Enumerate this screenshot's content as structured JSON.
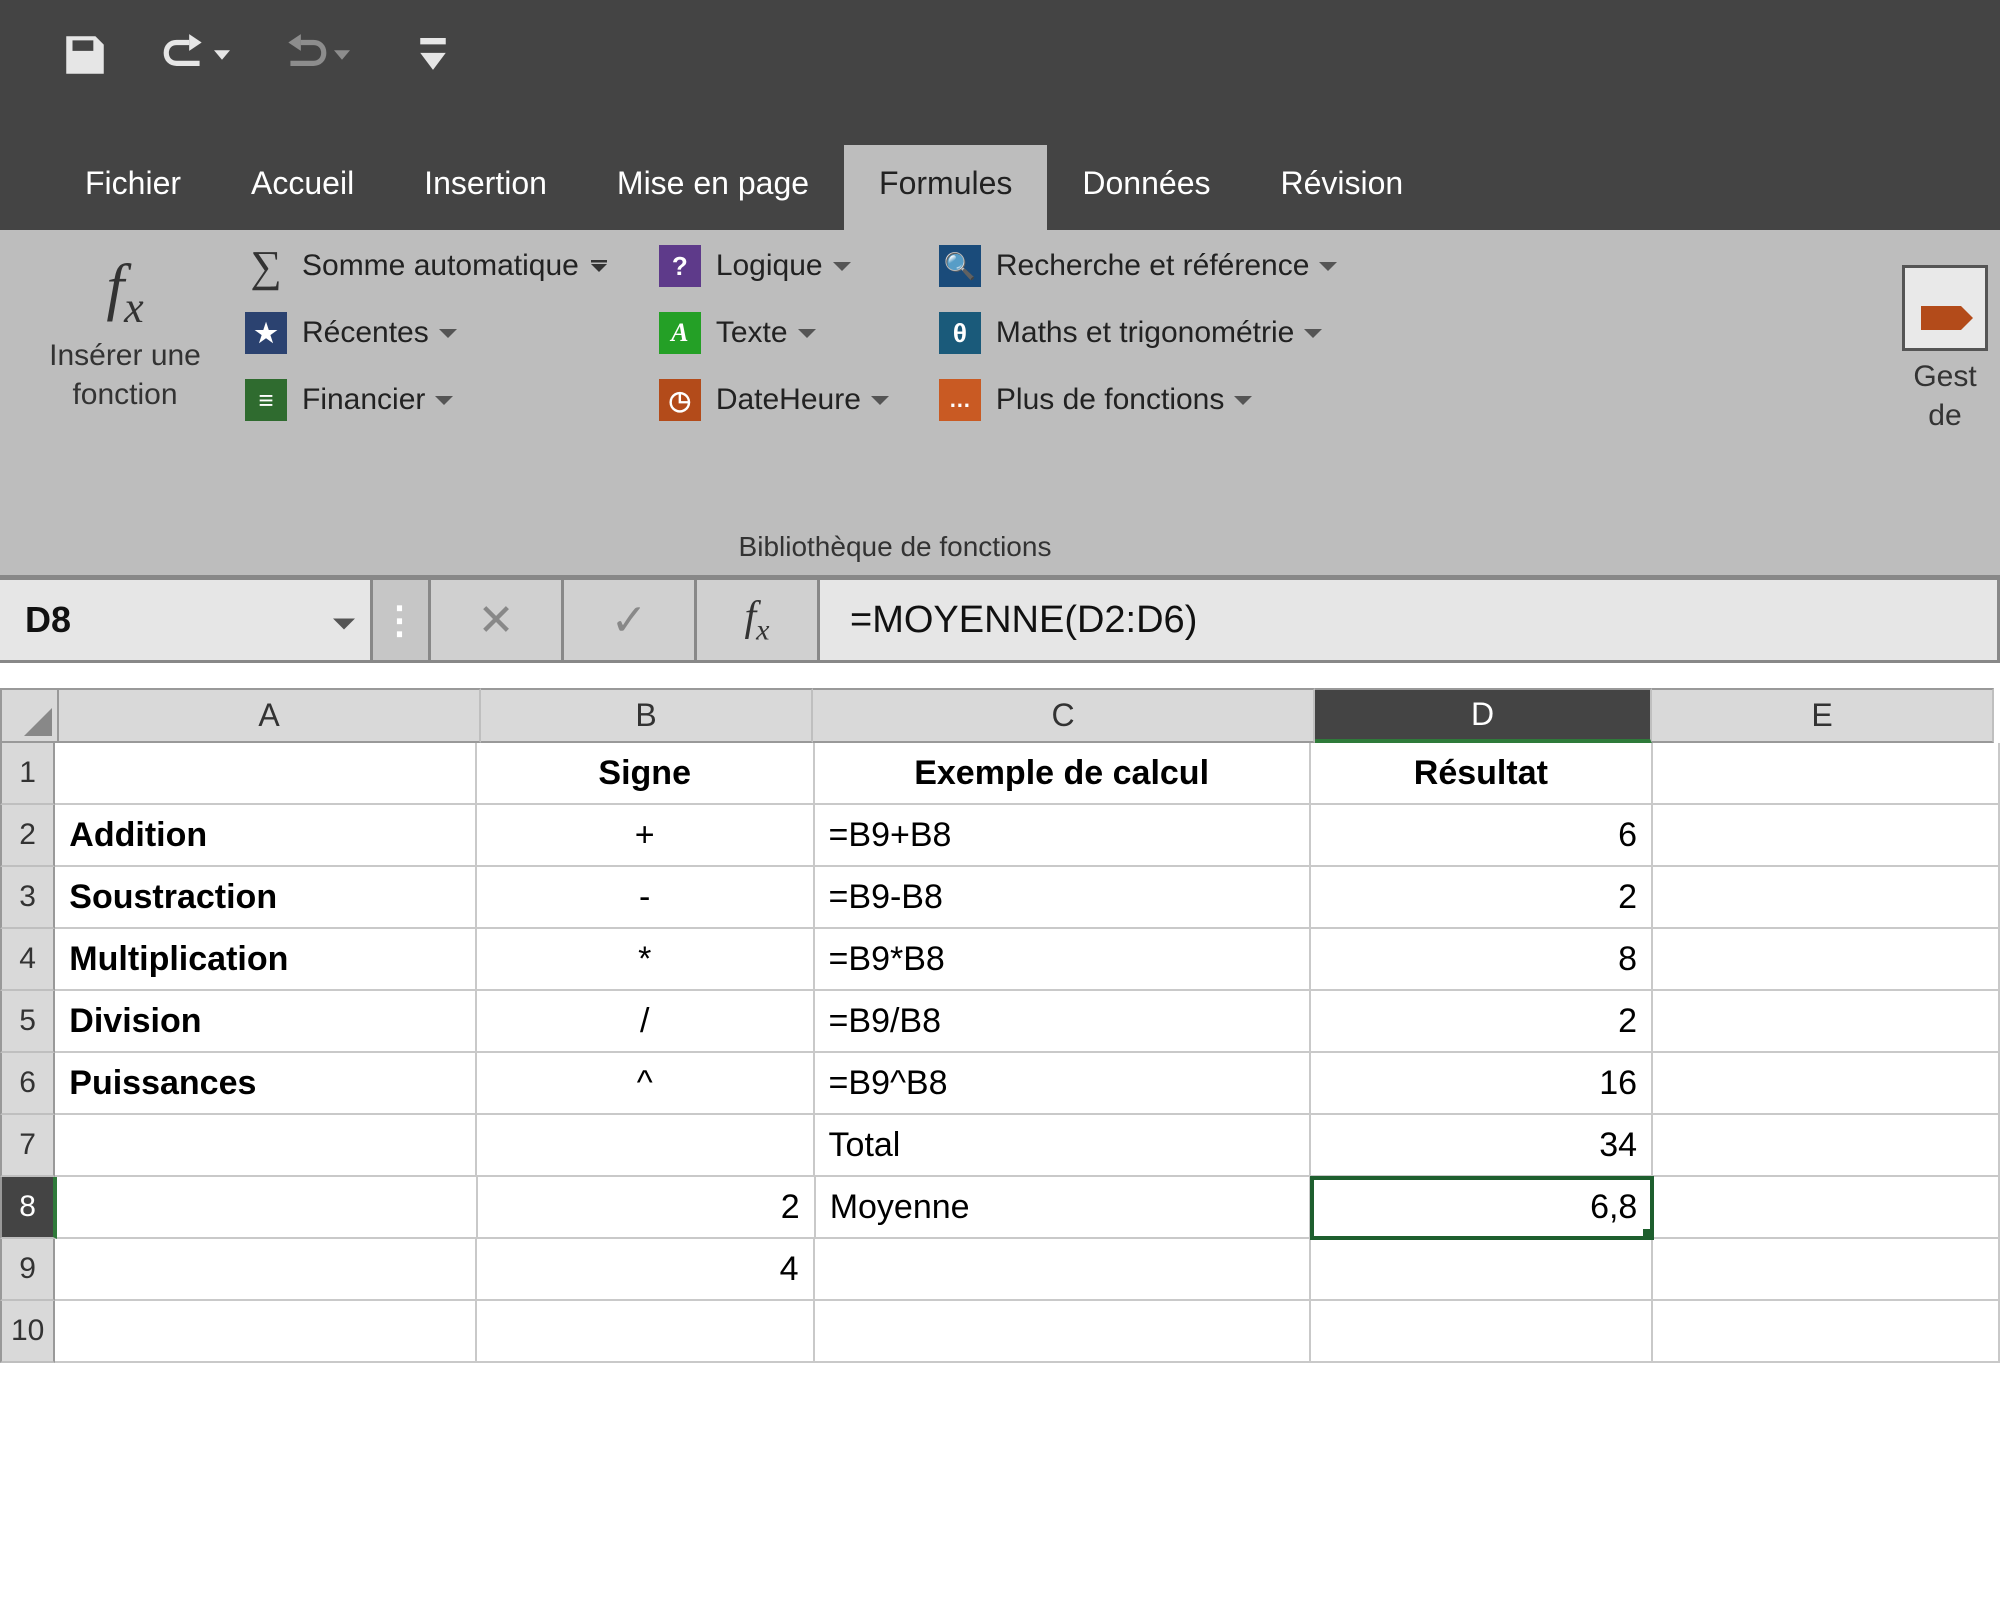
{
  "qat": {
    "undo_enabled": true,
    "redo_enabled": false
  },
  "tabs": {
    "items": [
      "Fichier",
      "Accueil",
      "Insertion",
      "Mise en page",
      "Formules",
      "Données",
      "Révision"
    ],
    "selected": "Formules"
  },
  "ribbon": {
    "insert_function": {
      "fx": "fx",
      "label_line1": "Insérer une",
      "label_line2": "fonction"
    },
    "library_group_label": "Bibliothèque de fonctions",
    "library": {
      "autosum": "Somme automatique",
      "recent": "Récentes",
      "financial": "Financier",
      "logical": "Logique",
      "text": "Texte",
      "datetime": "DateHeure",
      "lookup": "Recherche et référence",
      "math": "Maths et trigonométrie",
      "more": "Plus de fonctions"
    },
    "names": {
      "label_line1": "Gest",
      "label_line2": "de"
    }
  },
  "formula_bar": {
    "cell_ref": "D8",
    "formula": "=MOYENNE(D2:D6)"
  },
  "sheet": {
    "columns": [
      "A",
      "B",
      "C",
      "D",
      "E"
    ],
    "selected_cell": "D8",
    "rows": [
      {
        "n": 1,
        "A": "",
        "Abold": false,
        "B": "Signe",
        "Bcenter": true,
        "Bbold": true,
        "C": "Exemple de calcul",
        "Cbold": true,
        "Ccenter": true,
        "D": "Résultat",
        "Dright": false,
        "Dbold": true,
        "Dcenter": true
      },
      {
        "n": 2,
        "A": "Addition",
        "Abold": true,
        "B": "+",
        "Bcenter": true,
        "C": "=B9+B8",
        "D": "6",
        "Dright": true
      },
      {
        "n": 3,
        "A": "Soustraction",
        "Abold": true,
        "B": "-",
        "Bcenter": true,
        "C": "=B9-B8",
        "D": "2",
        "Dright": true
      },
      {
        "n": 4,
        "A": "Multiplication",
        "Abold": true,
        "B": "*",
        "Bcenter": true,
        "C": "=B9*B8",
        "D": "8",
        "Dright": true
      },
      {
        "n": 5,
        "A": "Division",
        "Abold": true,
        "B": "/",
        "Bcenter": true,
        "C": "=B9/B8",
        "D": "2",
        "Dright": true
      },
      {
        "n": 6,
        "A": "Puissances",
        "Abold": true,
        "B": "^",
        "Bcenter": true,
        "C": "=B9^B8",
        "D": "16",
        "Dright": true
      },
      {
        "n": 7,
        "A": "",
        "B": "",
        "C": "Total",
        "D": "34",
        "Dright": true
      },
      {
        "n": 8,
        "A": "",
        "B": "2",
        "Bright": true,
        "C": "Moyenne",
        "D": "6,8",
        "Dright": true,
        "Dselected": true
      },
      {
        "n": 9,
        "A": "",
        "B": "4",
        "Bright": true,
        "C": "",
        "D": ""
      },
      {
        "n": 10,
        "A": "",
        "B": "",
        "C": "",
        "D": ""
      }
    ]
  }
}
